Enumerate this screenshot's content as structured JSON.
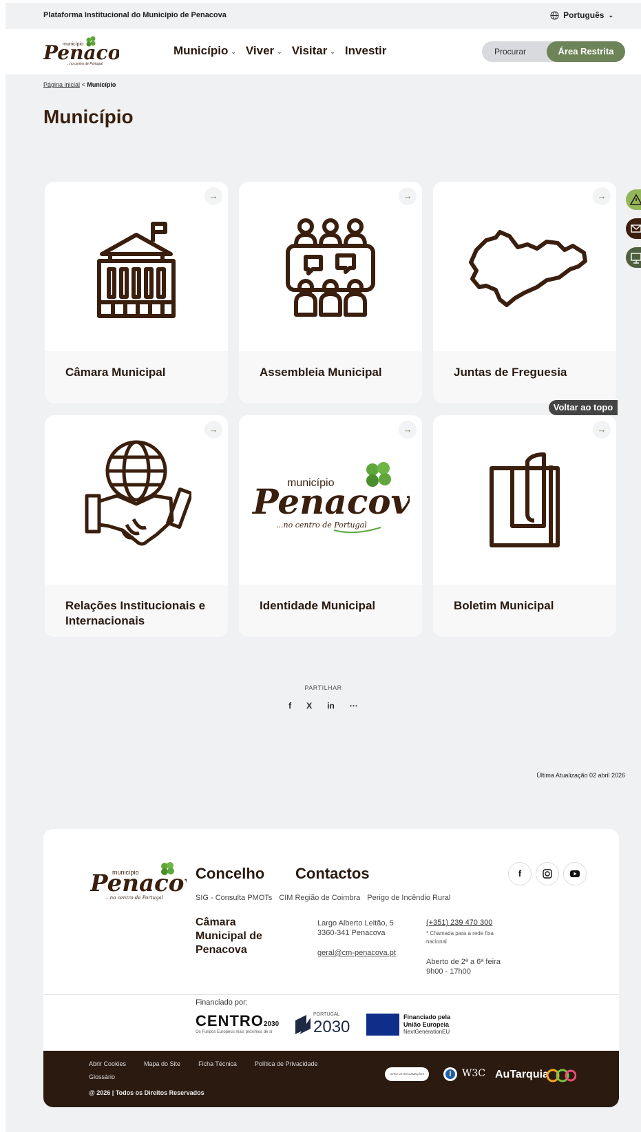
{
  "topbar": {
    "institutional": "Plataforma Institucional do Município de Penacova",
    "language": "Português"
  },
  "header": {
    "logo_text": "Penacova",
    "logo_small": "município",
    "logo_tagline": "...no centro de Portugal",
    "nav": [
      "Município",
      "Viver",
      "Visitar",
      "Investir"
    ],
    "search_label": "Procurar",
    "restricted_label": "Área Restrita"
  },
  "breadcrumb": {
    "home": "Página inicial",
    "separator": "<",
    "current": "Município"
  },
  "page_title": "Município",
  "cards": [
    {
      "label": "Câmara Municipal",
      "icon": "town-hall-icon"
    },
    {
      "label": "Assembleia Municipal",
      "icon": "assembly-icon"
    },
    {
      "label": "Juntas de Freguesia",
      "icon": "map-outline-icon"
    },
    {
      "label": "Relações Institucionais e Internacionais",
      "icon": "handshake-globe-icon"
    },
    {
      "label": "Identidade Municipal",
      "icon": "penacova-logo"
    },
    {
      "label": "Boletim Municipal",
      "icon": "bulletin-icon"
    }
  ],
  "back_to_top": "Voltar ao topo",
  "share": {
    "label": "PARTILHAR",
    "icons": [
      "f",
      "X",
      "in",
      "···"
    ]
  },
  "last_update": "Última Atualização 02 abril 2026",
  "footer": {
    "concelho": "Concelho",
    "contactos": "Contactos",
    "links": [
      "SIG - Consulta PMOTs",
      "CIM Região de Coimbra",
      "Perigo de Incêndio Rural"
    ],
    "cm_name": "Câmara Municipal de Penacova",
    "address_1": "Largo Alberto Leitão, 5",
    "address_2": "3360-341 Penacova",
    "email": "geral@cm-penacova.pt",
    "phone": "(+351) 239 470 300",
    "phone_note": "* Chamada para a rede fixa nacional",
    "hours": "Aberto de 2ª a 6ª feira",
    "hours_time": "9h00 - 17h00",
    "financed_by": "Financiado por:",
    "centro": "CENTRO",
    "centro_year": "2030",
    "centro_sub": "Os Fundos Europeus mais próximos de si",
    "portugal2030_small": "PORTUGAL",
    "portugal2030": "2030",
    "eu_line1": "Financiado pela",
    "eu_line2": "União Europeia",
    "eu_line3": "NextGenerationEU",
    "bottom_links": [
      "Abrir Cookies",
      "Mapa do Site",
      "Ficha Técnica",
      "Política de Privacidade"
    ],
    "glossary": "Glossário",
    "copyright": "@ 2026 | Todos os Direitos Reservados",
    "livro": "LIVRO DE RECLAMAÇÕES",
    "w3c": "W3C",
    "autarquia": "AuTarquia"
  },
  "colors": {
    "brand_brown": "#3a1f0e",
    "brand_green": "#6d8459",
    "page_bg": "#f0f1f3"
  }
}
